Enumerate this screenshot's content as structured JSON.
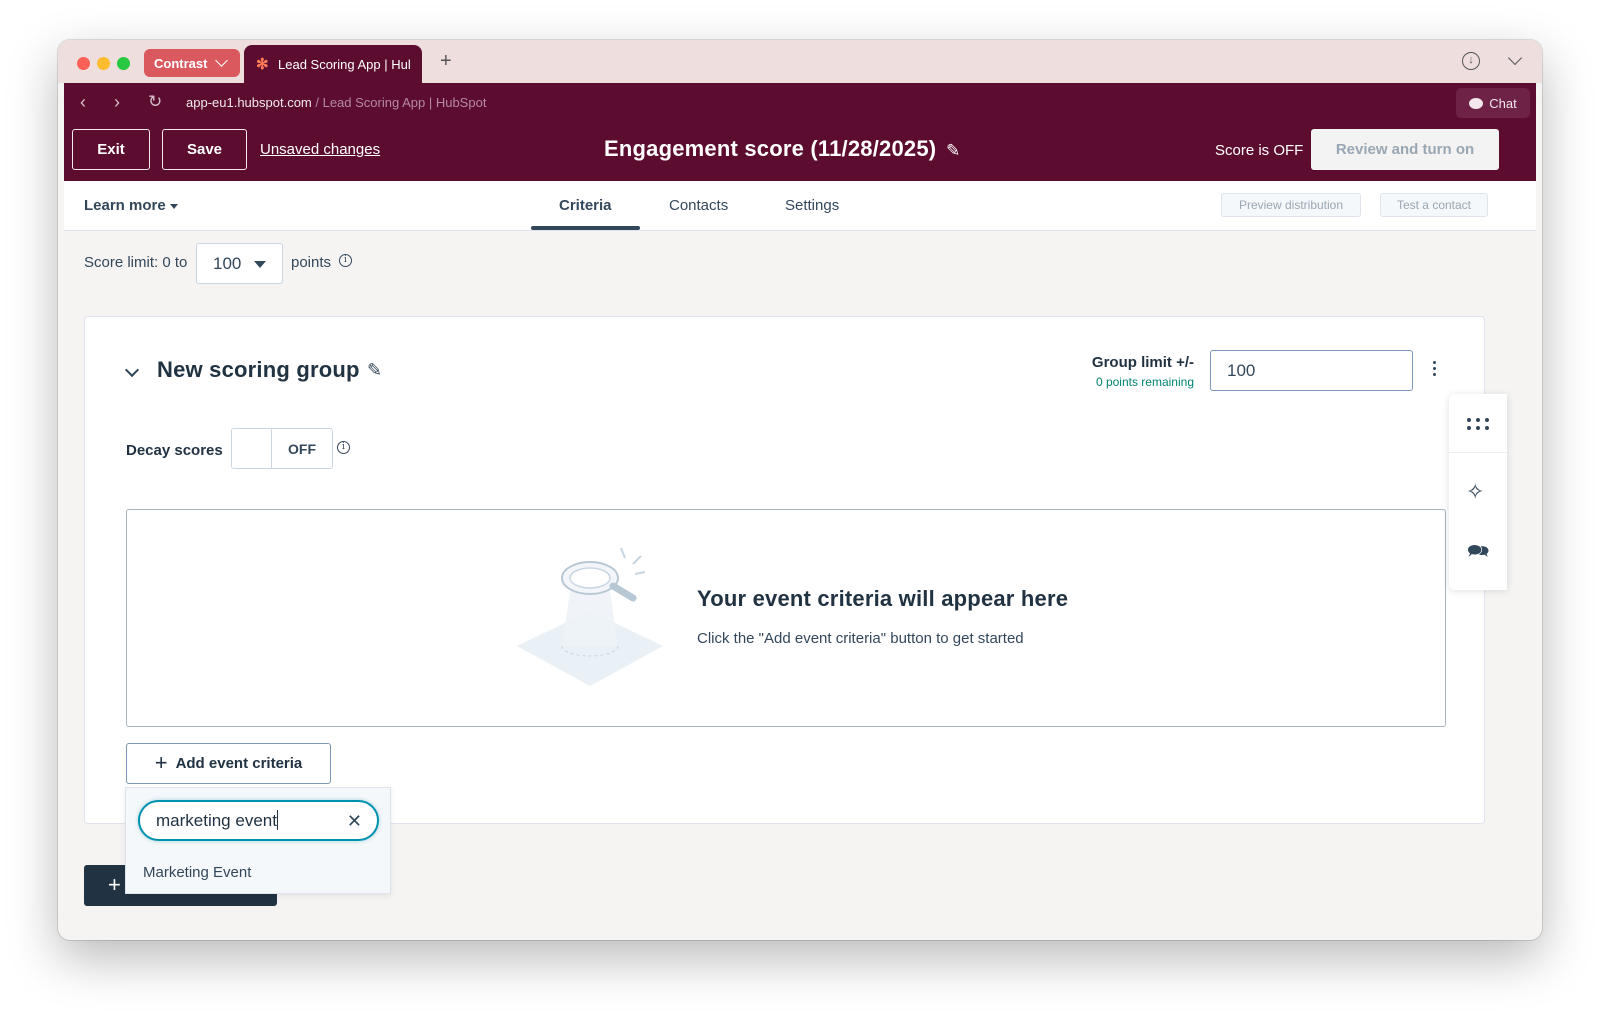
{
  "browser": {
    "contrast_label": "Contrast",
    "tab_title": "Lead Scoring App | Hul",
    "url_domain": "app-eu1.hubspot.com",
    "url_path": " / Lead Scoring App | HubSpot",
    "chat_label": "Chat"
  },
  "header": {
    "exit_label": "Exit",
    "save_label": "Save",
    "unsaved_label": "Unsaved changes",
    "title": "Engagement score (11/28/2025)",
    "score_status": "Score is OFF",
    "review_label": "Review and turn on"
  },
  "subnav": {
    "learn_more": "Learn more",
    "tabs": [
      {
        "label": "Criteria",
        "active": true
      },
      {
        "label": "Contacts",
        "active": false
      },
      {
        "label": "Settings",
        "active": false
      }
    ],
    "preview_label": "Preview distribution",
    "test_label": "Test a contact"
  },
  "score_limit": {
    "label": "Score limit: 0 to",
    "value": "100",
    "unit": "points"
  },
  "group": {
    "title": "New scoring group",
    "limit_label": "Group limit +/-",
    "remaining": "0 points remaining",
    "limit_value": "100",
    "decay_label": "Decay scores",
    "decay_state": "OFF",
    "empty_title": "Your event criteria will appear here",
    "empty_subtitle": "Click the \"Add event criteria\" button to get started",
    "add_criteria_label": "Add event criteria"
  },
  "dropdown": {
    "search_value": "marketing event",
    "options": [
      "Marketing Event"
    ]
  },
  "icons": {
    "edit": "pencil-icon",
    "info": "info-icon",
    "rail": [
      "apps-grid-icon",
      "sparkle-icon",
      "messages-icon"
    ]
  },
  "colors": {
    "brand_dark": "#5c0d2f",
    "focus": "#0091ae",
    "success_text": "#00856f"
  }
}
